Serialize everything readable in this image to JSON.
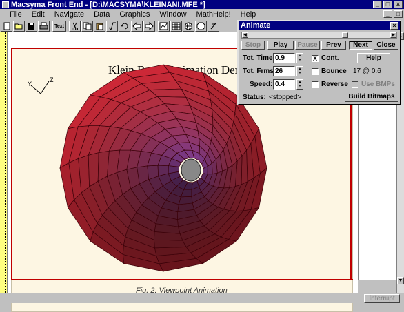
{
  "window": {
    "title": "Macsyma Front End - [D:\\MACSYMA\\KLEINANI.MFE *]",
    "buttons": {
      "minimize": "_",
      "maximize": "□",
      "close": "×"
    }
  },
  "menu": {
    "items": [
      "File",
      "Edit",
      "Navigate",
      "Data",
      "Graphics",
      "Window",
      "MathHelp!",
      "Help"
    ]
  },
  "toolbar": {
    "text_button": "Text",
    "tools": [
      "new-icon",
      "open-icon",
      "save-icon",
      "print-icon",
      "text-icon",
      "cut-icon",
      "copy-icon",
      "paste-icon",
      "math-icon",
      "undo-icon",
      "back-arrow-icon",
      "forward-arrow-icon",
      "graph-icon",
      "sheet-icon",
      "globe-icon",
      "stop-icon",
      "help-icon"
    ]
  },
  "plot": {
    "title": "Klein Bottle Animation Demo",
    "caption": "Fig. 2: Viewpoint Animation",
    "axis_y": "Y",
    "axis_z": "Z"
  },
  "status_bar": {
    "interrupt": "Interrupt"
  },
  "animate_dialog": {
    "title": "Animate",
    "close_glyph": "×",
    "buttons": {
      "stop": "Stop",
      "play": "Play",
      "pause": "Pause",
      "prev": "Prev",
      "next": "Next",
      "close": "Close",
      "help": "Help",
      "build_bitmaps": "Build Bitmaps"
    },
    "fields": {
      "tot_time_label": "Tot. Time:",
      "tot_time_value": "0.9",
      "tot_frms_label": "Tot. Frms:",
      "tot_frms_value": "26",
      "speed_label": "Speed:",
      "speed_value": "0.4"
    },
    "checkboxes": {
      "cont": {
        "label": "Cont.",
        "checked": true,
        "mark": "X"
      },
      "bounce": {
        "label": "Bounce",
        "checked": false
      },
      "reverse": {
        "label": "Reverse",
        "checked": false
      },
      "use_bmps": {
        "label": "Use BMPs",
        "checked": false,
        "disabled": true
      }
    },
    "frame_readout": "17 @ 0.6",
    "status_label": "Status:",
    "status_value": "<stopped>",
    "slider_position": 0.69
  }
}
